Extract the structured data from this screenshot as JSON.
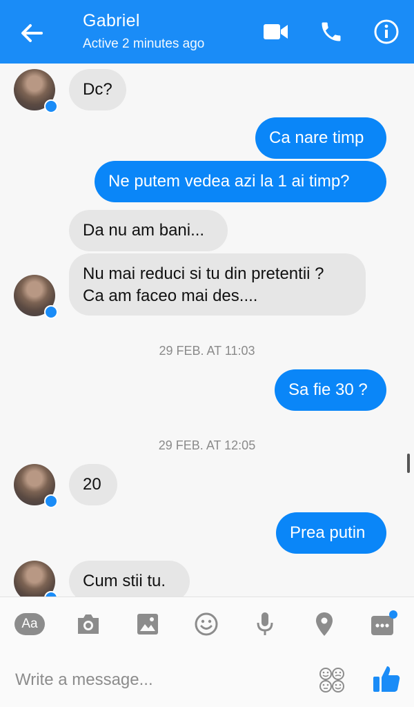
{
  "header": {
    "contact_name": "Gabriel",
    "status": "Active 2 minutes ago",
    "accent_color": "#1a8cf7",
    "icons": [
      "back-arrow-icon",
      "video-call-icon",
      "phone-icon",
      "info-icon"
    ]
  },
  "messages": [
    {
      "direction": "incoming",
      "text": "Dc?"
    },
    {
      "direction": "outgoing",
      "text": "Ca nare timp"
    },
    {
      "direction": "outgoing",
      "text": "Ne putem vedea azi la 1 ai timp?"
    },
    {
      "direction": "incoming",
      "text": "Da nu am bani..."
    },
    {
      "direction": "incoming",
      "text": "Nu mai reduci si tu din pretentii ?\nCa am faceo mai des...."
    },
    {
      "direction": "outgoing",
      "text": "Sa fie 30 ?"
    },
    {
      "direction": "incoming",
      "text": "20"
    },
    {
      "direction": "outgoing",
      "text": "Prea putin"
    },
    {
      "direction": "incoming",
      "text": "Cum stii tu."
    }
  ],
  "timestamps": [
    "29 FEB. AT 11:03",
    "29 FEB. AT 12:05"
  ],
  "toolbar": {
    "text_mode_label": "Aa",
    "icons": [
      "text-mode-icon",
      "camera-icon",
      "gallery-icon",
      "emoji-icon",
      "microphone-icon",
      "location-icon",
      "more-icon"
    ],
    "more_has_notification": true
  },
  "composer": {
    "placeholder": "Write a message...",
    "icons": [
      "stickers-icon",
      "like-icon"
    ]
  }
}
